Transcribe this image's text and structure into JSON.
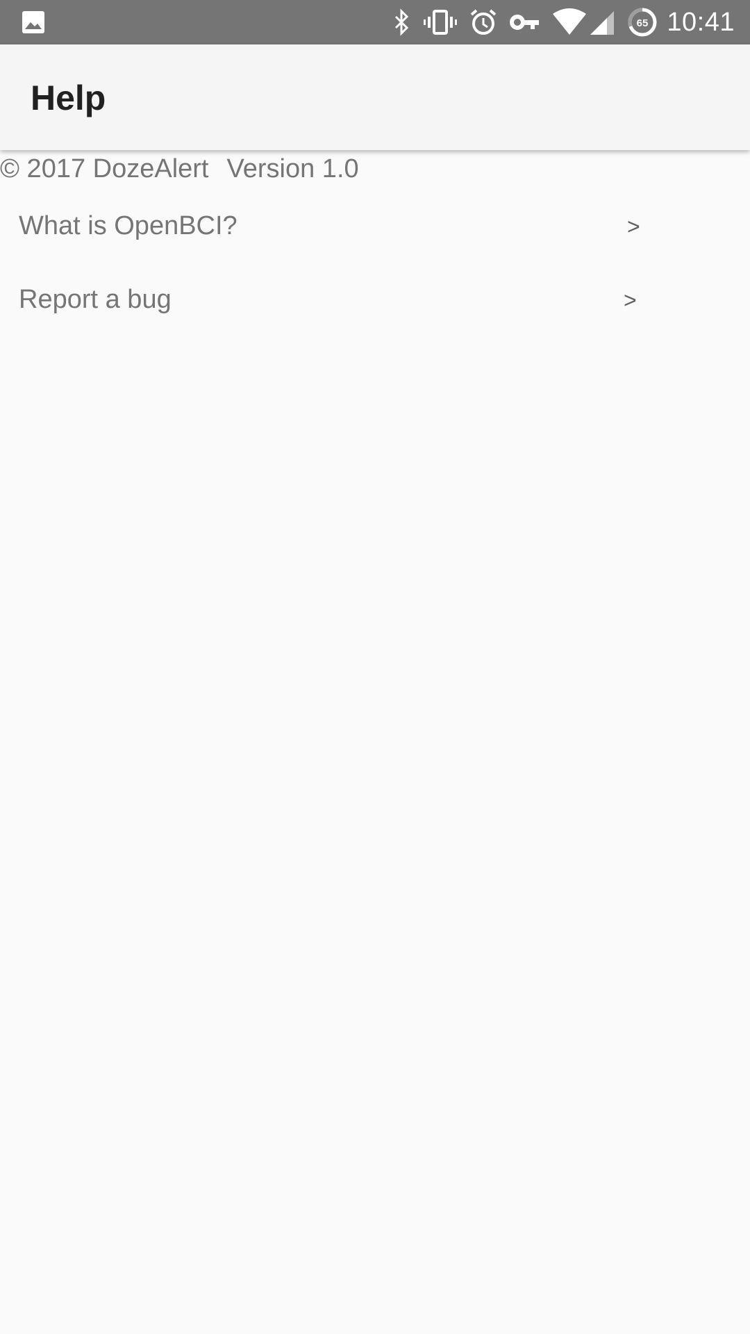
{
  "status_bar": {
    "time": "10:41",
    "battery_level": "65",
    "icons": [
      "image-icon",
      "bluetooth-icon",
      "vibrate-icon",
      "alarm-icon",
      "vpn-key-icon",
      "wifi-icon",
      "cell-signal-icon",
      "battery-saver-icon"
    ],
    "background_color": "#757575"
  },
  "app_bar": {
    "title": "Help",
    "background_color": "#f5f5f5"
  },
  "footer": {
    "copyright": "© 2017 DozeAlert",
    "version": "Version 1.0"
  },
  "help_items": [
    {
      "label": "What is OpenBCI?",
      "chevron": ">"
    },
    {
      "label": "Report a bug",
      "chevron": ">"
    }
  ]
}
